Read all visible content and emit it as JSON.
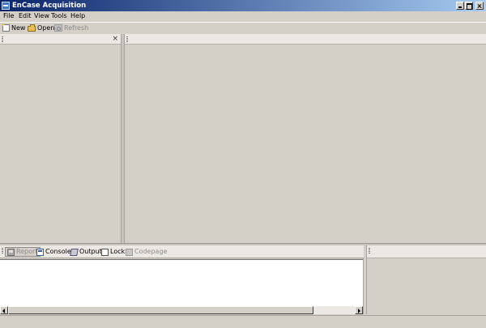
{
  "window": {
    "title": "EnCase Acquisition",
    "icon": "encase-app-icon",
    "controls": [
      "minimize-icon",
      "maximize-icon",
      "close-icon"
    ]
  },
  "menubar": {
    "items": [
      {
        "label": "File"
      },
      {
        "label": "Edit"
      },
      {
        "label": "View"
      },
      {
        "label": "Tools"
      },
      {
        "label": "Help"
      }
    ]
  },
  "toolbar": {
    "buttons": [
      {
        "label": "New",
        "icon": "new-document-icon",
        "enabled": true
      },
      {
        "label": "Open",
        "icon": "open-folder-icon",
        "enabled": true
      },
      {
        "label": "Refresh",
        "icon": "refresh-icon",
        "enabled": false
      }
    ]
  },
  "left_pane": {
    "close_glyph": "×"
  },
  "bottom_pane": {
    "tabs": [
      {
        "label": "Report",
        "icon": "report-icon",
        "active": true
      },
      {
        "label": "Console",
        "icon": "console-icon",
        "active": false
      },
      {
        "label": "Output",
        "icon": "output-icon",
        "active": false
      },
      {
        "label": "Lock",
        "icon": "lock-checkbox-icon",
        "active": false
      },
      {
        "label": "Codepage",
        "icon": "codepage-checkbox-icon",
        "active": false,
        "enabled": false
      }
    ]
  },
  "colors": {
    "titlebar_start": "#0a246a",
    "titlebar_end": "#a6caf0",
    "face": "#d4d0c8",
    "disabled_text": "#8c8c8c"
  }
}
